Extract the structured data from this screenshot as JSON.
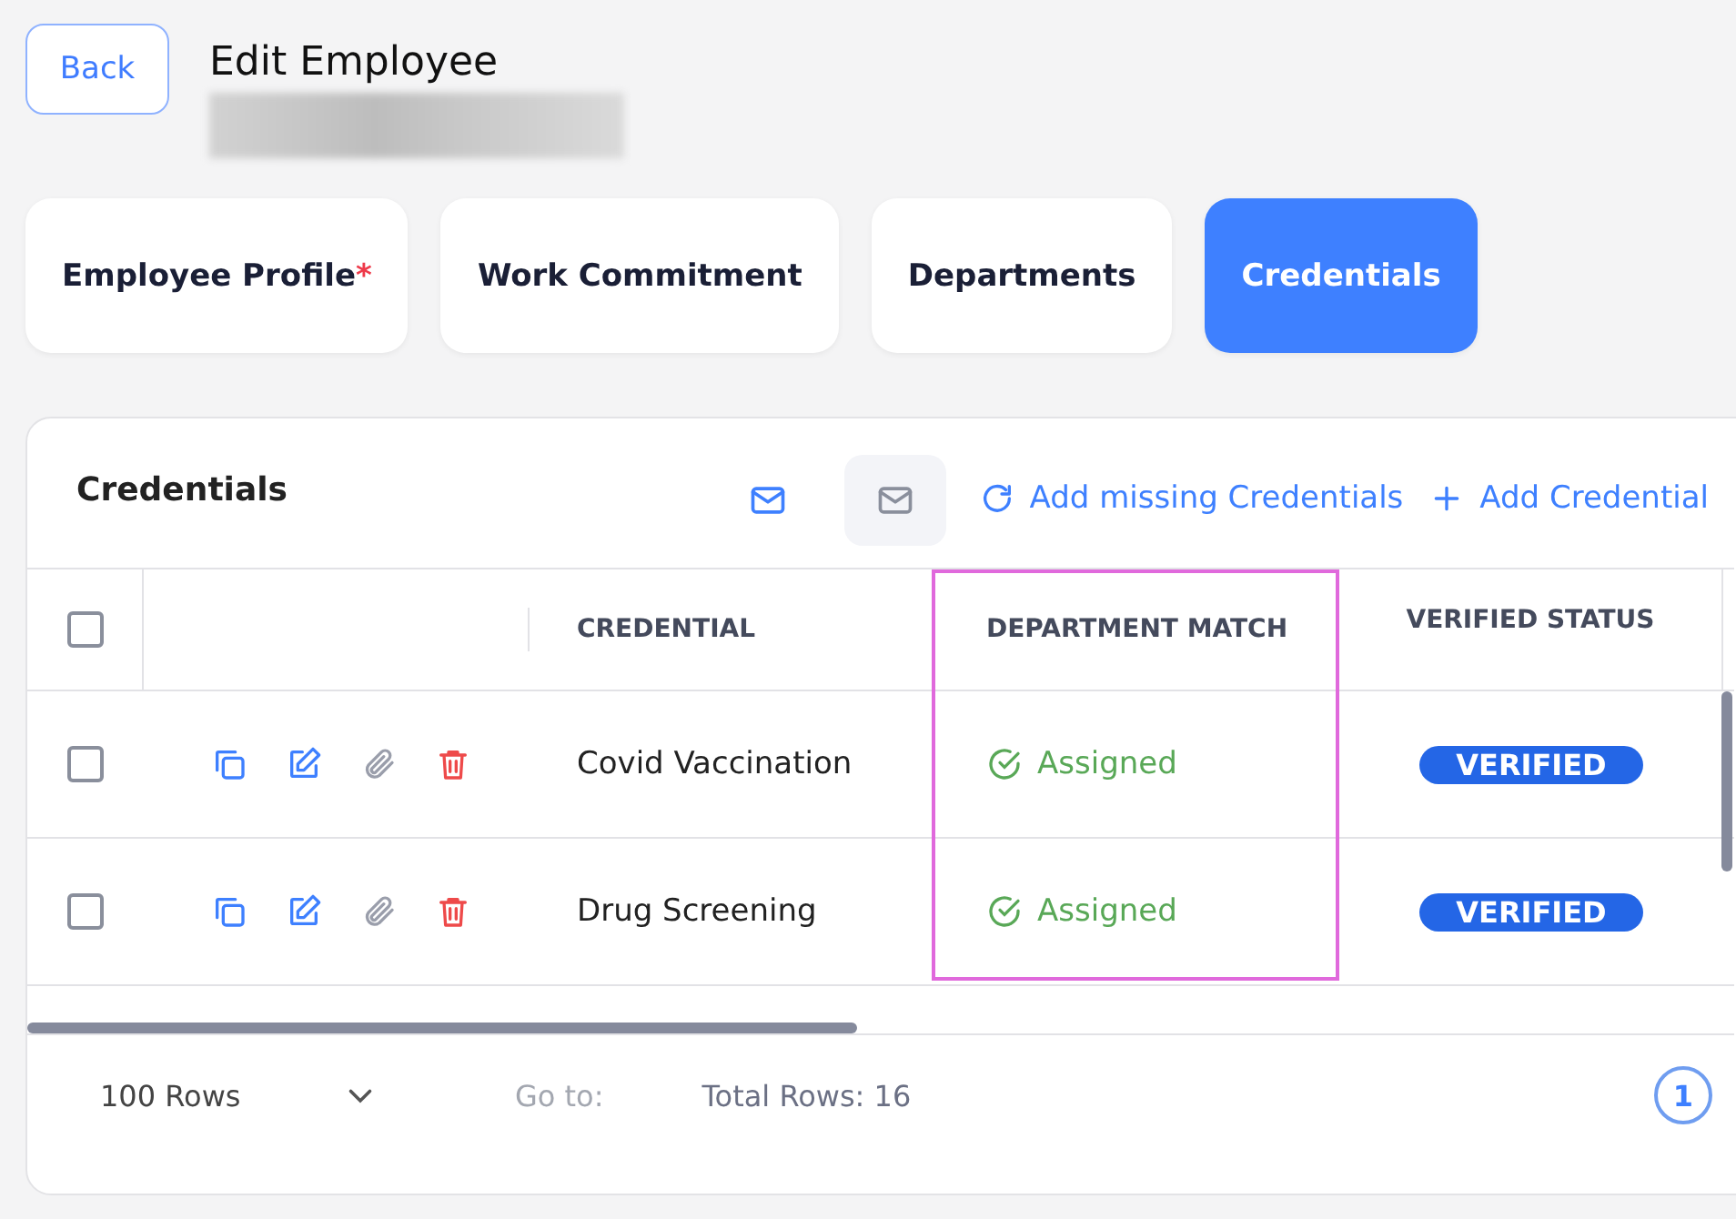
{
  "page": {
    "back_button": "Back",
    "title": "Edit Employee"
  },
  "tabs": [
    {
      "label": "Employee Profile",
      "required_mark": "*",
      "selected": false
    },
    {
      "label": "Work Commitment",
      "selected": false
    },
    {
      "label": "Departments",
      "selected": false
    },
    {
      "label": "Credentials",
      "selected": true
    }
  ],
  "panel": {
    "title": "Credentials",
    "actions": [
      {
        "kind": "refresh",
        "label": "Add missing Credentials"
      },
      {
        "kind": "add",
        "label": "Add Credential"
      }
    ]
  },
  "table": {
    "all_checked": false,
    "columns": [
      "CREDENTIAL",
      "DEPARTMENT MATCH",
      "VERIFIED STATUS"
    ],
    "rows": [
      {
        "checked": false,
        "credential": "Covid Vaccination",
        "department_match": "Assigned",
        "verified_status": "VERIFIED"
      },
      {
        "checked": false,
        "credential": "Drug Screening",
        "department_match": "Assigned",
        "verified_status": "VERIFIED"
      }
    ]
  },
  "footer": {
    "rows_per_page": "100 Rows",
    "goto_label": "Go to:",
    "total": "Total Rows: 16",
    "pages": [
      {
        "label": "1",
        "selected": true
      }
    ]
  }
}
